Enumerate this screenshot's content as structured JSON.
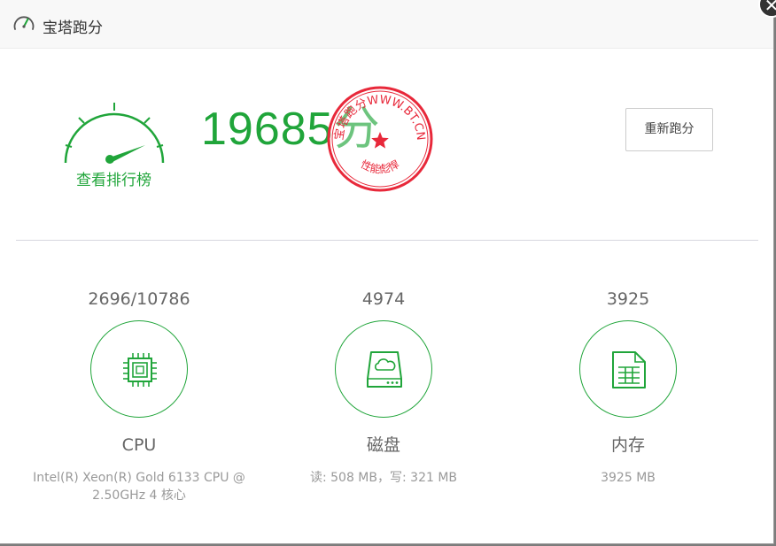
{
  "window": {
    "title": "宝塔跑分",
    "close_symbol": "✕"
  },
  "gauge": {
    "link_label": "查看排行榜"
  },
  "score": {
    "value": "19685",
    "unit": "分"
  },
  "stamp": {
    "top_text": "宝塔跑分WWW.BT.CN",
    "bottom_text": "性能彪悍"
  },
  "actions": {
    "rerun_label": "重新跑分"
  },
  "metrics": [
    {
      "value": "2696/10786",
      "name": "CPU",
      "detail": "Intel(R) Xeon(R) Gold 6133 CPU @ 2.50GHz 4 核心"
    },
    {
      "value": "4974",
      "name": "磁盘",
      "detail": "读: 508 MB，写: 321 MB"
    },
    {
      "value": "3925",
      "name": "内存",
      "detail": "3925 MB"
    }
  ],
  "colors": {
    "accent": "#20a53a",
    "stamp": "#e8283a",
    "text": "#666666",
    "muted": "#999999"
  }
}
